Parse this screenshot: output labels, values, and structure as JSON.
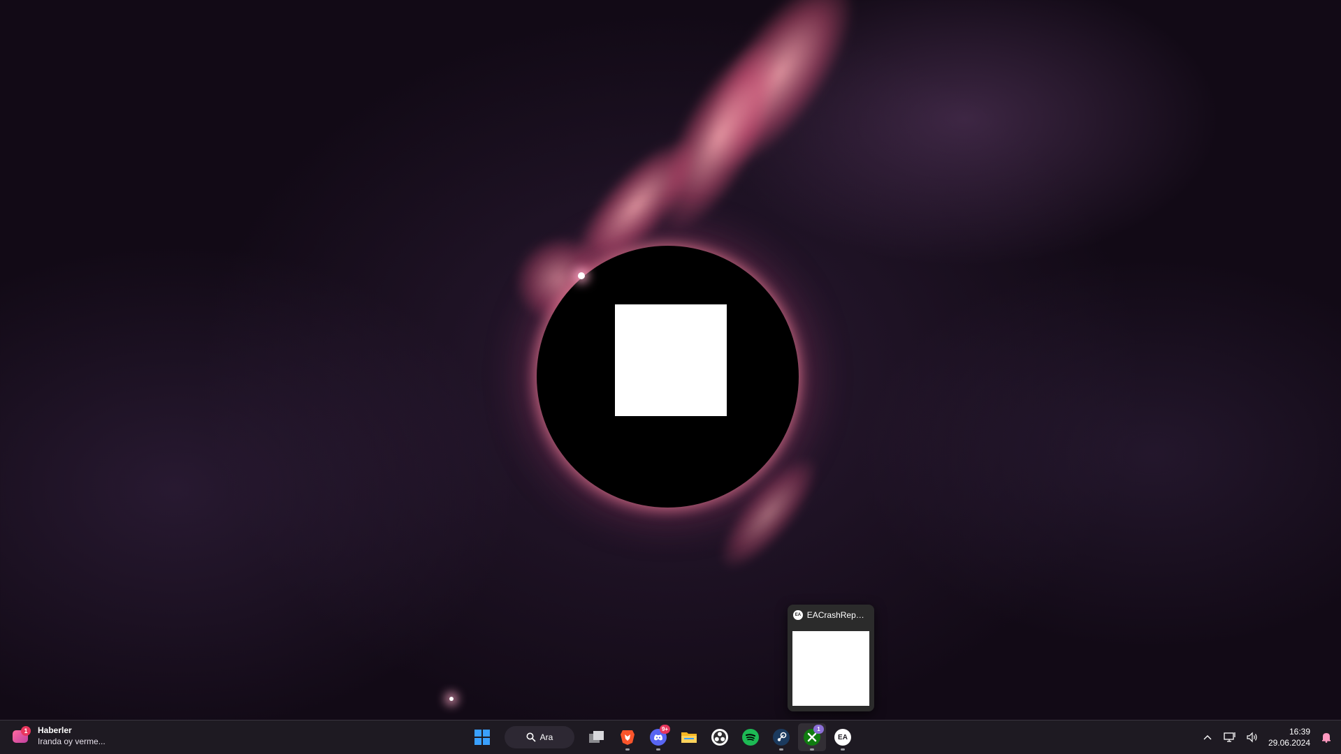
{
  "desktop": {
    "wallpaper": "black-hole-nebula",
    "accent_colors": {
      "nebula": "#c75a7a",
      "background": "#120a16"
    }
  },
  "taskbar_preview": {
    "app_icon": "ea-crash-reporter-icon",
    "title": "EACrashRepor..."
  },
  "taskbar": {
    "widgets": {
      "badge": "1",
      "title": "Haberler",
      "subtitle": "Iranda oy verme..."
    },
    "start_icon": "windows-start-icon",
    "search": {
      "label": "Ara",
      "icon": "search-icon"
    },
    "apps": [
      {
        "name": "task-view",
        "icon": "task-view-icon",
        "running": false
      },
      {
        "name": "brave",
        "icon": "brave-icon",
        "running": true
      },
      {
        "name": "discord",
        "icon": "discord-icon",
        "running": true,
        "badge": "9+"
      },
      {
        "name": "file-explorer",
        "icon": "folder-icon",
        "running": false
      },
      {
        "name": "obs",
        "icon": "obs-icon",
        "running": false
      },
      {
        "name": "spotify",
        "icon": "spotify-icon",
        "running": false
      },
      {
        "name": "steam",
        "icon": "steam-icon",
        "running": true
      },
      {
        "name": "xbox",
        "icon": "xbox-icon",
        "running": true,
        "active": true,
        "badge": "1"
      },
      {
        "name": "ea",
        "icon": "ea-icon",
        "running": true,
        "label": "EA"
      }
    ],
    "tray": {
      "icons": [
        "chevron-up-icon",
        "network-icon",
        "volume-icon"
      ],
      "time": "16:39",
      "date": "29.06.2024",
      "notification_icon": "bell-icon"
    }
  }
}
